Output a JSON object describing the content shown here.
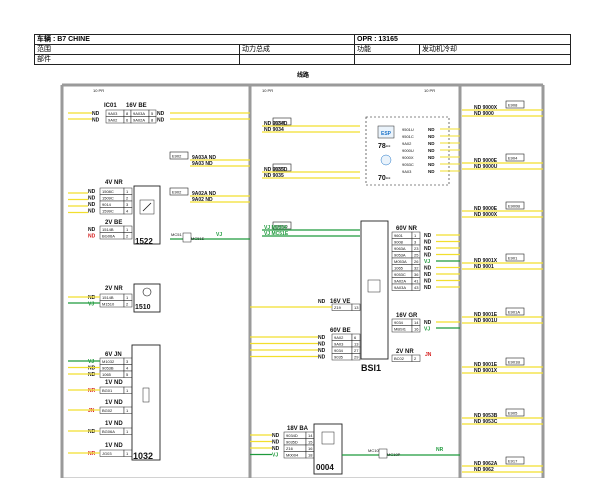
{
  "header": {
    "vehicle": "车辆 : B7 CHINE",
    "opr": "OPR : 13165",
    "scope": "范围",
    "scope_value": "动力总成",
    "function_label": "功能",
    "function_value": "发动机冷却",
    "part": "部件"
  },
  "section_title": "线路",
  "grid": {
    "left": "10 PR",
    "mid": "10 PR",
    "right": "10 PR"
  },
  "colors": {
    "yellow": "#f2df2e",
    "green": "#1e9a3c",
    "red": "#d51c1c",
    "grid": "#9a9a9a",
    "line": "#222222"
  },
  "connectors": {
    "c1522": {
      "id": "1522",
      "color": "4V NR",
      "pins": [
        [
          "1508C",
          "1"
        ],
        [
          "1509C",
          "2"
        ],
        [
          "9014",
          "3"
        ],
        [
          "1599C",
          "4"
        ]
      ],
      "nd_labels": [
        "ND",
        "ND",
        "ND",
        "ND"
      ]
    },
    "c1522b": {
      "color": "2V BE",
      "pins": [
        [
          "1514B",
          "1"
        ],
        [
          "BG06A",
          "2"
        ]
      ],
      "nd_labels": [
        "ND",
        "ND"
      ]
    },
    "c1510": {
      "id": "1510",
      "color": "2V NR",
      "pins": [
        [
          "1514B",
          "1"
        ],
        [
          "M1510",
          "2"
        ]
      ],
      "nd_labels": [
        "ND",
        "VJ"
      ]
    },
    "c1032": {
      "id": "1032",
      "c6": {
        "color": "6V JN",
        "pins": [
          [
            "M1032",
            "3"
          ],
          [
            "9053B",
            "4"
          ],
          [
            "1065",
            "5"
          ]
        ],
        "nd_labels": [
          "VJ",
          "ND",
          "ND"
        ]
      },
      "c1a": {
        "color": "1V ND",
        "pins": [
          [
            "BG01",
            "1"
          ]
        ],
        "nd": "NR"
      },
      "c1b": {
        "color": "1V ND",
        "pins": [
          [
            "BG02",
            "1"
          ]
        ],
        "nd": "JN"
      },
      "c1c": {
        "color": "1V ND",
        "pins": [
          [
            "BG06A",
            "1"
          ]
        ],
        "nd": "ND"
      },
      "c1d": {
        "color": "1V ND",
        "pins": [
          [
            "JG03",
            "1"
          ]
        ],
        "nd": "NR"
      }
    },
    "ic01": {
      "title": "IC01",
      "color": "16V BE",
      "pins": [
        [
          "9A03",
          "8"
        ],
        [
          "9A02",
          "6"
        ]
      ],
      "right": [
        [
          "9A03A",
          "5"
        ],
        [
          "9A02A",
          "8"
        ]
      ],
      "nd_labels": [
        "ND",
        "ND"
      ],
      "nd_right": [
        "ND",
        "ND"
      ]
    },
    "c0004": {
      "id": "0004",
      "color": "18V BA",
      "pins": [
        [
          "9034D",
          "14"
        ],
        [
          "9035D",
          "15"
        ],
        [
          "Z16",
          "16"
        ],
        [
          "M0004",
          "18"
        ]
      ],
      "nd_labels": [
        "ND",
        "ND",
        "ND",
        "VJ"
      ]
    },
    "bsi1": {
      "id": "BSI1",
      "c60nr": {
        "color": "60V NR",
        "pins": [
          [
            "9601",
            "1"
          ],
          [
            "9008",
            "3"
          ],
          [
            "9063A",
            "23"
          ],
          [
            "9053A",
            "25"
          ],
          [
            "M053A",
            "26"
          ],
          [
            "1065",
            "32"
          ],
          [
            "9053C",
            "36"
          ],
          [
            "9A02A",
            "41"
          ],
          [
            "9A03A",
            "43"
          ]
        ],
        "nd_labels": [
          "ND",
          "ND",
          "ND",
          "ND",
          "VJ",
          "ND",
          "ND",
          "ND",
          "ND"
        ]
      },
      "c16ve": {
        "color": "16V VE",
        "pins": [
          [
            "Z19",
            "13"
          ]
        ],
        "nd_labels": [
          "ND"
        ]
      },
      "c60be": {
        "color": "60V BE",
        "pins": [
          [
            "9A02",
            "6"
          ],
          [
            "9A03",
            "13"
          ],
          [
            "9034",
            "27"
          ],
          [
            "9035",
            "29"
          ]
        ],
        "nd_labels": [
          "ND",
          "ND",
          "ND",
          "ND"
        ]
      },
      "c16gr": {
        "color": "16V GR",
        "pins": [
          [
            "9034",
            "14"
          ],
          [
            "MBSI1",
            "16"
          ]
        ],
        "nd_labels": [
          "ND",
          "VJ"
        ]
      },
      "c2nr": {
        "color": "2V NR",
        "pins": [
          [
            "BC02",
            "2"
          ]
        ],
        "nd_labels": [
          "JN"
        ]
      }
    }
  },
  "boxes_center": {
    "e904": {
      "id": "E904",
      "wires": [
        "ND 9034D",
        "ND 9034"
      ]
    },
    "e902a": {
      "id": "E902",
      "wires": [
        "9A03A ND",
        "9A03 ND"
      ]
    },
    "e905": {
      "id": "E905",
      "wires": [
        "ND 9035D",
        "ND 9035"
      ]
    },
    "e902b": {
      "id": "E902",
      "wires": [
        "9A02A ND",
        "9A02 ND"
      ]
    },
    "em516": {
      "id": "EM516",
      "wires": [
        "VJ M0004",
        "VJ MC51E"
      ]
    },
    "mc51": {
      "left": "MC51",
      "right": "MC51E",
      "wire": "VJ"
    },
    "mc10": {
      "left": "MC10",
      "right": "MC10P",
      "wire": "NR"
    }
  },
  "esp_block": {
    "esp": "ESP",
    "esp_num": "78--",
    "rr_num": "70--",
    "pins": [
      "9501U",
      "9501C",
      "9A02",
      "9000U",
      "9000X",
      "9053C",
      "9A03"
    ],
    "nd": [
      "ND",
      "ND",
      "ND",
      "ND",
      "ND",
      "ND",
      "ND"
    ]
  },
  "right_boxes": [
    {
      "id": "E908",
      "wires": [
        "ND 9000X",
        "ND 9000"
      ]
    },
    {
      "id": "E904",
      "wires": [
        "ND 9000E",
        "ND 9000U"
      ]
    },
    {
      "id": "E900B",
      "wires": [
        "ND 9000E",
        "ND 9000X"
      ]
    },
    {
      "id": "E901",
      "wires": [
        "ND 9001X",
        "ND 9001"
      ]
    },
    {
      "id": "E901A",
      "wires": [
        "ND 9001E",
        "ND 9001U"
      ]
    },
    {
      "id": "E901B",
      "wires": [
        "ND 9001E",
        "ND 9001X"
      ]
    },
    {
      "id": "E905",
      "wires": [
        "ND 9053B",
        "ND 9053C"
      ]
    },
    {
      "id": "E917",
      "wires": [
        "ND 9062A",
        "ND 9062"
      ]
    }
  ]
}
